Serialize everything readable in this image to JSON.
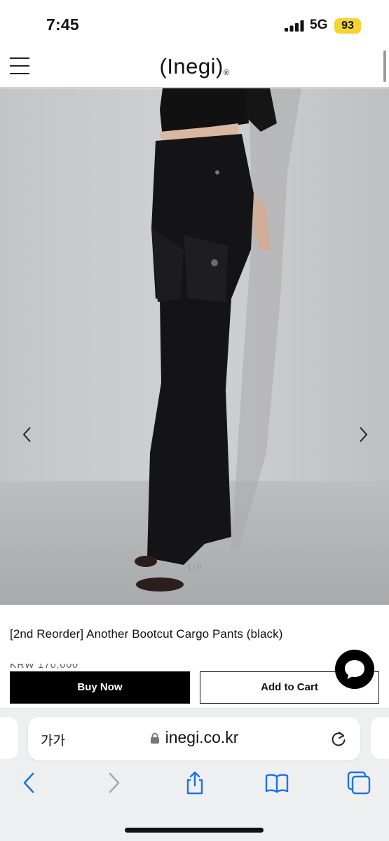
{
  "status_bar": {
    "time": "7:45",
    "network": "5G",
    "battery": "93",
    "battery_color": "#f3d431"
  },
  "header": {
    "logo": "(Inegi)",
    "logo_mark": "®",
    "menu_icon": "hamburger-icon"
  },
  "gallery": {
    "pager": "1/9",
    "prev_icon": "chevron-left-icon",
    "next_icon": "chevron-right-icon"
  },
  "product": {
    "title": "[2nd Reorder] Another Bootcut Cargo Pants (black)",
    "price_partial": "KRW 170,000"
  },
  "actions": {
    "buy_now": "Buy Now",
    "add_to_cart": "Add to Cart",
    "chat_icon": "chat-bubble-icon"
  },
  "browser": {
    "text_size_label": "가가",
    "url": "inegi.co.kr",
    "icons": [
      "back-icon",
      "forward-icon",
      "share-icon",
      "bookmarks-icon",
      "tabs-icon"
    ],
    "accent_color": "#1a73e8"
  }
}
